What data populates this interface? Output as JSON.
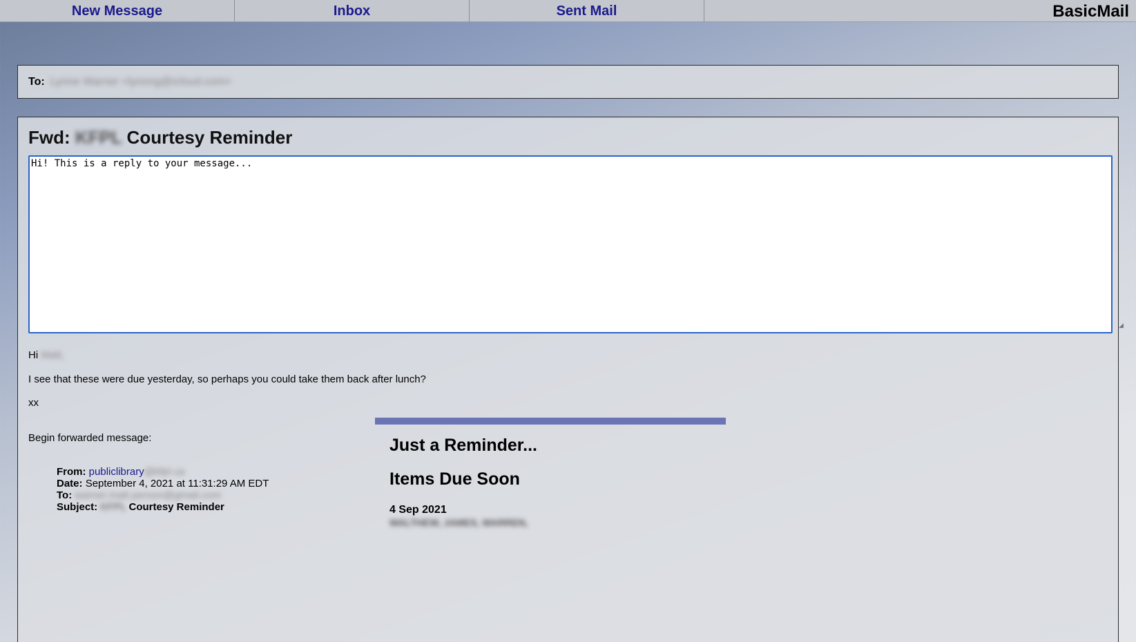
{
  "nav": {
    "tabs": [
      "New Message",
      "Inbox",
      "Sent Mail"
    ],
    "brand": "BasicMail"
  },
  "to_field": {
    "label": "To:",
    "value_redacted": "Lynne Warner <lynnng@icloud.com>"
  },
  "message": {
    "subject_prefix": "Fwd:",
    "subject_redacted": "KFPL",
    "subject_suffix": "Courtesy Reminder",
    "reply_text": "Hi! This is a reply to your message...",
    "greeting": "Hi",
    "greeting_name_redacted": "Matt,",
    "body_line": "I see that these were due yesterday, so perhaps you could take them back after lunch?",
    "signoff": "xx",
    "forward_intro": "Begin forwarded message:",
    "fwd": {
      "from_label": "From:",
      "from_value": "publiclibrary",
      "from_redacted": "@kfpl.ca",
      "date_label": "Date:",
      "date_value": "September 4, 2021 at 11:31:29 AM EDT",
      "to_label": "To:",
      "to_redacted": "warner.matt.person@gmail.com",
      "subject_label": "Subject:",
      "subject_redacted": "KFPL",
      "subject_value": "Courtesy Reminder"
    },
    "reminder": {
      "heading1": "Just a Reminder...",
      "heading2": "Items Due Soon",
      "date": "4 Sep 2021",
      "line_redacted": "WALTHEW, JAMES, WARREN,"
    }
  },
  "colors": {
    "link": "#1a1a8c",
    "textarea_border": "#2a64c8",
    "reminder_bar": "#6b74b4"
  }
}
